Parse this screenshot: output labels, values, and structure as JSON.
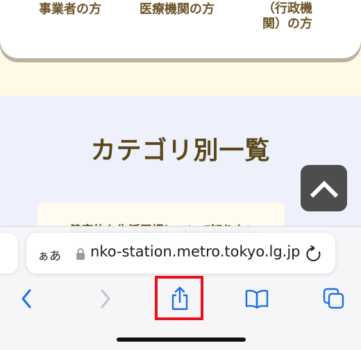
{
  "header_nav": {
    "items": [
      {
        "label": "事業者の方"
      },
      {
        "label": "医療機関の方"
      },
      {
        "label": "市区町村（行政機関）の方"
      }
    ]
  },
  "main": {
    "section_title": "カテゴリ別一覧",
    "card_partial_text": "健康的な生活習慣について知りたい"
  },
  "safari": {
    "text_size_label": "ぁあ",
    "url": "nko-station.metro.tokyo.lg.jp",
    "toolbar": {
      "back_icon": "chevron-left-icon",
      "forward_icon": "chevron-right-icon",
      "share_icon": "share-icon",
      "bookmarks_icon": "book-icon",
      "tabs_icon": "tabs-icon"
    }
  },
  "colors": {
    "accent_brown": "#5a4718",
    "ios_blue": "#1a6ee6",
    "highlight_red": "#e8101a",
    "cream_bg": "#fff9e8",
    "lavender_bg": "#eef0fb"
  }
}
